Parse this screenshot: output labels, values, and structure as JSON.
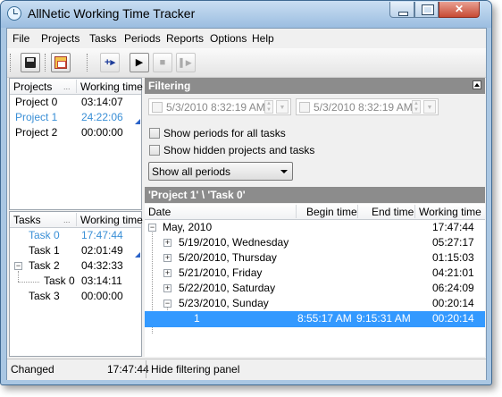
{
  "window": {
    "title": "AllNetic Working Time Tracker",
    "close_glyph": "✕"
  },
  "menu": [
    "File",
    "Projects",
    "Tasks",
    "Periods",
    "Reports",
    "Options",
    "Help"
  ],
  "toolbar": {
    "icons": [
      "save-icon",
      "calendar-icon",
      "start-task-icon",
      "play-icon",
      "stop-icon",
      "pause-resume-icon"
    ],
    "glyphs": {
      "start": "+▸",
      "play": "▶",
      "stop": "■",
      "resume": "▌▶"
    }
  },
  "projects": {
    "columns": {
      "name": "Projects",
      "ellipsis": "...",
      "time": "Working time"
    },
    "rows": [
      {
        "name": "Project 0",
        "time": "03:14:07"
      },
      {
        "name": "Project 1",
        "time": "24:22:06"
      },
      {
        "name": "Project 2",
        "time": "00:00:00"
      }
    ]
  },
  "tasks": {
    "columns": {
      "name": "Tasks",
      "ellipsis": "...",
      "time": "Working time"
    },
    "rows": [
      {
        "name": "Task 0",
        "time": "17:47:44"
      },
      {
        "name": "Task 1",
        "time": "02:01:49"
      },
      {
        "name": "Task 2",
        "time": "04:32:33",
        "expander": "−"
      },
      {
        "name": "Task 0",
        "time": "03:14:11"
      },
      {
        "name": "Task 3",
        "time": "00:00:00"
      }
    ]
  },
  "filtering": {
    "title": "Filtering",
    "from_date": "5/3/2010 8:32:19 AM",
    "to_date": "5/3/2010 8:32:19 AM",
    "show_all_tasks_label": "Show periods for all tasks",
    "show_hidden_label": "Show hidden projects and tasks",
    "period_select": "Show all periods"
  },
  "periods": {
    "path": "'Project 1' \\ 'Task 0'",
    "columns": {
      "date": "Date",
      "begin": "Begin time",
      "end": "End time",
      "time": "Working time"
    },
    "month": {
      "label": "May, 2010",
      "time": "17:47:44",
      "expander": "−"
    },
    "days": [
      {
        "label": "5/19/2010, Wednesday",
        "time": "05:27:17",
        "expander": "+"
      },
      {
        "label": "5/20/2010, Thursday",
        "time": "01:15:03",
        "expander": "+"
      },
      {
        "label": "5/21/2010, Friday",
        "time": "04:21:01",
        "expander": "+"
      },
      {
        "label": "5/22/2010, Saturday",
        "time": "06:24:09",
        "expander": "+"
      },
      {
        "label": "5/23/2010, Sunday",
        "time": "00:20:14",
        "expander": "−"
      }
    ],
    "entry": {
      "num": "1",
      "begin": "8:55:17 AM",
      "end": "9:15:31 AM",
      "time": "00:20:14"
    }
  },
  "status": {
    "state": "Changed",
    "time": "17:47:44",
    "hint": "Hide filtering panel"
  }
}
